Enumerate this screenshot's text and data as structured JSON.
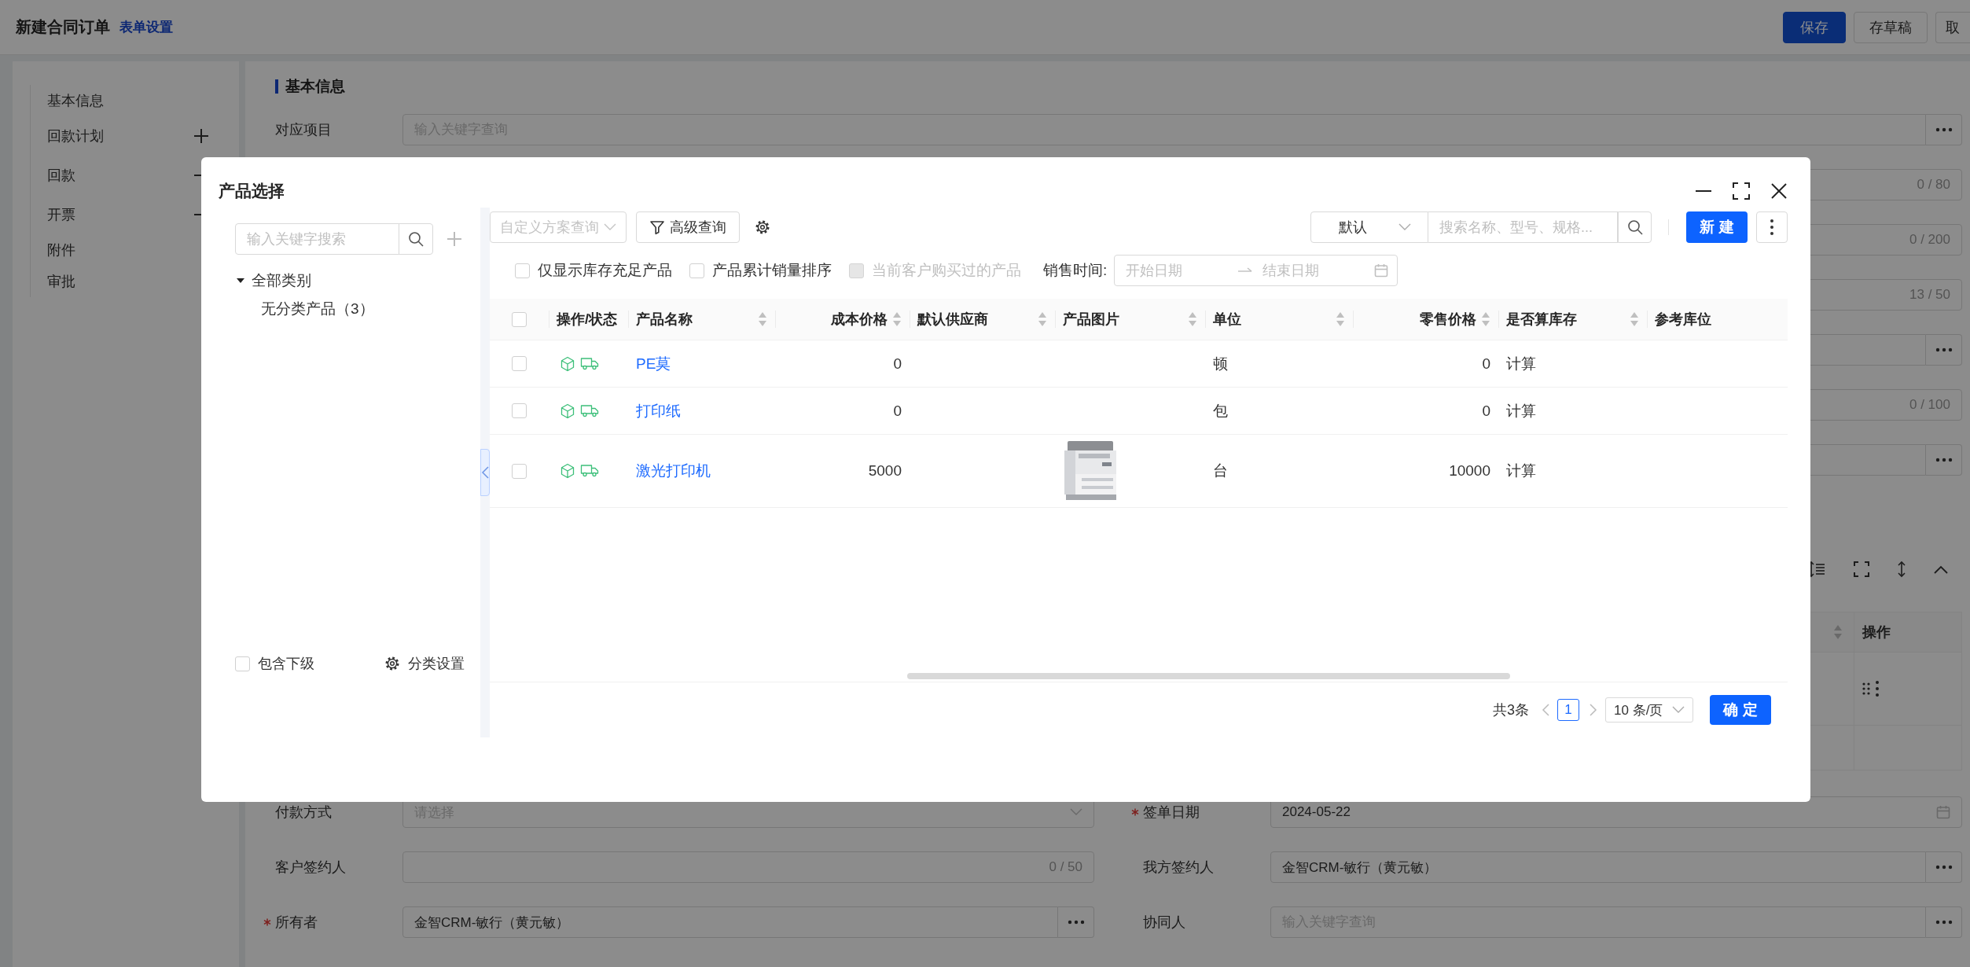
{
  "header": {
    "title": "新建合同订单",
    "link": "表单设置",
    "buttons": [
      {
        "label": "保存",
        "kind": "primary"
      },
      {
        "label": "存草稿",
        "kind": "default"
      },
      {
        "label": "取",
        "kind": "default"
      }
    ]
  },
  "nav": [
    {
      "label": "基本信息",
      "kind": "plain"
    },
    {
      "label": "回款计划",
      "kind": "add"
    },
    {
      "label": "回款",
      "kind": "collapse"
    },
    {
      "label": "开票",
      "kind": "collapse"
    },
    {
      "label": "附件",
      "kind": "plain"
    },
    {
      "label": "审批",
      "kind": "plain"
    }
  ],
  "section_title": "基本信息",
  "top_fields": [
    {
      "label": "对应项目",
      "kind": "picker",
      "placeholder": "输入关键字查询"
    }
  ],
  "covered_rows": [
    {
      "kind": "counter",
      "counter": "0 / 80"
    },
    {
      "kind": "counter",
      "counter": "0 / 200"
    },
    {
      "kind": "counter",
      "counter": "13 / 50"
    },
    {
      "kind": "picker"
    },
    {
      "kind": "counter",
      "counter": "0 / 100"
    },
    {
      "kind": "picker"
    }
  ],
  "detail_table": {
    "action_column": "操作"
  },
  "bottom_fields": [
    [
      {
        "label": "付款方式",
        "required": false,
        "kind": "select",
        "placeholder": "请选择"
      },
      {
        "label": "签单日期",
        "required": true,
        "kind": "date",
        "value": "2024-05-22"
      }
    ],
    [
      {
        "label": "客户签约人",
        "required": false,
        "kind": "counter",
        "counter": "0 / 50"
      },
      {
        "label": "我方签约人",
        "required": false,
        "kind": "picker",
        "value": "金智CRM-敏行（黄元敏）"
      }
    ],
    [
      {
        "label": "所有者",
        "required": true,
        "kind": "picker",
        "value": "金智CRM-敏行（黄元敏）"
      },
      {
        "label": "协同人",
        "required": false,
        "kind": "picker",
        "placeholder": "输入关键字查询"
      }
    ]
  ],
  "modal": {
    "title": "产品选择",
    "category_search": {
      "placeholder": "输入关键字搜索"
    },
    "tree": [
      {
        "label": "全部类别",
        "expanded": true,
        "children": [
          {
            "label": "无分类产品（3）"
          }
        ]
      }
    ],
    "include_children": {
      "label": "包含下级",
      "checked": false
    },
    "category_settings": "分类设置",
    "scheme_select": {
      "placeholder": "自定义方案查询",
      "disabled": true
    },
    "advanced_query": "高级查询",
    "sort_select": {
      "value": "默认"
    },
    "search": {
      "placeholder": "搜索名称、型号、规格..."
    },
    "new_button": "新建",
    "filters": [
      {
        "label": "仅显示库存充足产品",
        "checked": false,
        "disabled": false
      },
      {
        "label": "产品累计销量排序",
        "checked": false,
        "disabled": false
      },
      {
        "label": "当前客户购买过的产品",
        "checked": false,
        "disabled": true
      }
    ],
    "date_range": {
      "label": "销售时间:",
      "start_placeholder": "开始日期",
      "end_placeholder": "结束日期"
    },
    "table": {
      "select_all": {
        "checked": false
      },
      "columns": [
        {
          "label": "操作/状态",
          "kind": "status",
          "sortable": false
        },
        {
          "label": "产品名称",
          "kind": "link",
          "sortable": true
        },
        {
          "label": "成本价格",
          "kind": "number",
          "sortable": true
        },
        {
          "label": "默认供应商",
          "kind": "text",
          "sortable": true
        },
        {
          "label": "产品图片",
          "sortable": true
        },
        {
          "label": "单位",
          "kind": "text",
          "sortable": true
        },
        {
          "label": "零售价格",
          "kind": "number",
          "sortable": true
        },
        {
          "label": "是否算库存",
          "kind": "text",
          "sortable": true
        },
        {
          "label": "参考库位",
          "kind": "text",
          "sortable": false
        }
      ],
      "rows": [
        {
          "checked": false,
          "cells": [
            null,
            "PE莫",
            "0",
            null,
            null,
            "顿",
            "0",
            "计算",
            null
          ]
        },
        {
          "checked": false,
          "cells": [
            null,
            "打印纸",
            "0",
            null,
            null,
            "包",
            "0",
            "计算",
            null
          ]
        },
        {
          "checked": false,
          "cells": [
            null,
            "激光打印机",
            "5000",
            null,
            {
              "kind": "picture"
            },
            "台",
            "10000",
            "计算",
            null
          ]
        }
      ]
    },
    "pagination": {
      "total": "共3条",
      "pages": [
        {
          "label": "1",
          "selected": true
        }
      ],
      "page_size": "10 条/页"
    },
    "confirm": "确定"
  }
}
